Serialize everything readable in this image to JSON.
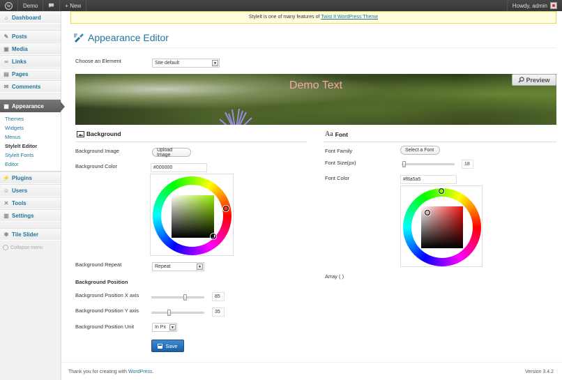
{
  "adminbar": {
    "site_name": "Demo",
    "new_label": "+ New",
    "howdy": "Howdy, admin"
  },
  "sidebar": {
    "items": [
      {
        "label": "Dashboard",
        "icon": "dashboard-icon"
      },
      {
        "label": "Posts",
        "icon": "pin-icon"
      },
      {
        "label": "Media",
        "icon": "media-icon"
      },
      {
        "label": "Links",
        "icon": "link-icon"
      },
      {
        "label": "Pages",
        "icon": "pages-icon"
      },
      {
        "label": "Comments",
        "icon": "comment-icon"
      },
      {
        "label": "Appearance",
        "icon": "appearance-icon"
      },
      {
        "label": "Plugins",
        "icon": "plugin-icon"
      },
      {
        "label": "Users",
        "icon": "users-icon"
      },
      {
        "label": "Tools",
        "icon": "tools-icon"
      },
      {
        "label": "Settings",
        "icon": "settings-icon"
      },
      {
        "label": "Tile Slider",
        "icon": "slider-icon"
      }
    ],
    "submenu": [
      "Themes",
      "Widgets",
      "Menus",
      "Stylelt Editor",
      "Stylelt Fonts",
      "Editor"
    ],
    "collapse": "Collapse menu"
  },
  "notice": {
    "text": "Stylelt is one of many features of ",
    "link": "Twist It WordPress Theme"
  },
  "page": {
    "title": "Appearance Editor",
    "choose_label": "Choose an Element",
    "element_value": "Site default"
  },
  "preview": {
    "demo_text": "Demo Text",
    "button": "Preview"
  },
  "background": {
    "title": "Background",
    "image_label": "Background Image",
    "upload_button": "Upload Image",
    "color_label": "Background Color",
    "color_value": "#000000",
    "repeat_label": "Background Repeat",
    "repeat_value": "Repeat",
    "position_heading": "Background Position",
    "pos_x_label": "Background Position X axis",
    "pos_x_value": "85",
    "pos_y_label": "Background Position Y axis",
    "pos_y_value": "35",
    "unit_label": "Background Position Unit",
    "unit_value": "In Px",
    "save": "Save"
  },
  "font": {
    "title": "Font",
    "family_label": "Font Family",
    "select_button": "Select a Font",
    "size_label": "Font Size(px)",
    "size_value": "18",
    "color_label": "Font Color",
    "color_value": "#f8a5a5",
    "array_text": "Array ( )"
  },
  "footer": {
    "thanks": "Thank you for creating with ",
    "link": "WordPress",
    "version": "Version 3.4.2"
  },
  "colors": {
    "link": "#21759b",
    "demo_text": "#f8a5a5",
    "save_button": "#2a6fba"
  }
}
